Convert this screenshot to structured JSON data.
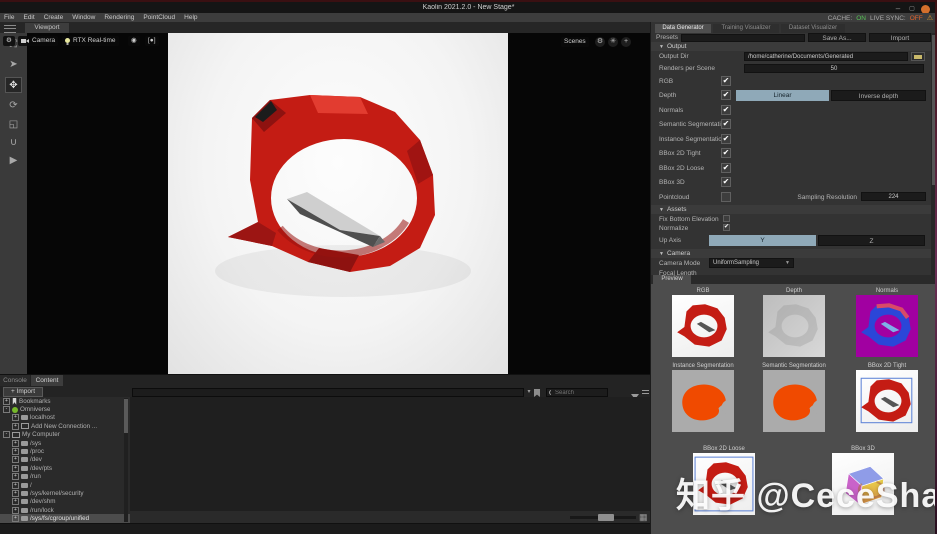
{
  "window": {
    "title": "Kaolin 2021.2.0 - New Stage*",
    "minimize": "–",
    "maximize": "▢",
    "cache_label": "CACHE:",
    "cache_value": "ON",
    "live_sync_label": "LIVE SYNC:",
    "live_sync_value": "OFF"
  },
  "menubar": {
    "items": [
      "File",
      "Edit",
      "Create",
      "Window",
      "Rendering",
      "PointCloud",
      "Help"
    ]
  },
  "viewport": {
    "tab_label": "Viewport",
    "camera_button": "Camera",
    "renderer_button": "RTX Real-time",
    "scenes_button": "Scenes",
    "speed_indicator": "[●]"
  },
  "generator": {
    "tabs": [
      "Data Generator",
      "Training Visualizer",
      "Dataset Visualizer"
    ],
    "active_tab": "Data Generator",
    "presets_label": "Presets",
    "save_as_button": "Save As...",
    "import_button": "Import",
    "output": {
      "header": "Output",
      "output_dir_label": "Output Dir",
      "output_dir_value": "/home/catherine/Documents/Generated",
      "renders_label": "Renders per Scene",
      "renders_value": "50",
      "rows": [
        {
          "label": "RGB",
          "checked": true
        },
        {
          "label": "Depth",
          "checked": true
        },
        {
          "label": "Normals",
          "checked": true
        },
        {
          "label": "Semantic Segmentation",
          "checked": true
        },
        {
          "label": "Instance Segmentation",
          "checked": true
        },
        {
          "label": "BBox 2D Tight",
          "checked": true
        },
        {
          "label": "BBox 2D Loose",
          "checked": true
        },
        {
          "label": "BBox 3D",
          "checked": true
        },
        {
          "label": "Pointcloud",
          "checked": false
        }
      ],
      "depth_mode_options": [
        "Linear",
        "Inverse depth"
      ],
      "depth_mode_selected": "Linear",
      "sampling_resolution_label": "Sampling Resolution",
      "sampling_resolution_value": "224"
    },
    "assets": {
      "header": "Assets",
      "fix_bottom_label": "Fix Bottom Elevation",
      "fix_bottom_checked": false,
      "normalize_label": "Normalize",
      "normalize_checked": true,
      "up_axis_label": "Up Axis",
      "up_axis_options": [
        "Y",
        "Z"
      ],
      "up_axis_selected": "Y"
    },
    "camera": {
      "header": "Camera",
      "mode_label": "Camera Mode",
      "mode_value": "UniformSampling",
      "focal_length_label": "Focal Length"
    },
    "preview": {
      "tab_label": "Preview",
      "thumb_labels": [
        "RGB",
        "Depth",
        "Normals",
        "Instance Segmentation",
        "Semantic Segmentation",
        "BBox 2D Tight",
        "BBox 2D Loose",
        "BBox 3D"
      ]
    }
  },
  "browser": {
    "console_tab": "Console",
    "content_tab": "Content",
    "active_tab": "Content",
    "import_button": "+ Import",
    "search_placeholder": "Search",
    "tree": [
      {
        "label": "Bookmarks",
        "toggle": "+",
        "icon": "bookmark",
        "depth": 0
      },
      {
        "label": "Omniverse",
        "toggle": "-",
        "icon": "omniverse",
        "depth": 0
      },
      {
        "label": "localhost",
        "toggle": "+",
        "icon": "server",
        "depth": 1
      },
      {
        "label": "Add New Connection ...",
        "toggle": "+",
        "icon": "connection",
        "depth": 1
      },
      {
        "label": "My Computer",
        "toggle": "-",
        "icon": "computer",
        "depth": 0
      },
      {
        "label": "/sys",
        "toggle": "+",
        "icon": "drive",
        "depth": 1
      },
      {
        "label": "/proc",
        "toggle": "+",
        "icon": "drive",
        "depth": 1
      },
      {
        "label": "/dev",
        "toggle": "+",
        "icon": "drive",
        "depth": 1
      },
      {
        "label": "/dev/pts",
        "toggle": "+",
        "icon": "drive",
        "depth": 1
      },
      {
        "label": "/run",
        "toggle": "+",
        "icon": "drive",
        "depth": 1
      },
      {
        "label": "/",
        "toggle": "+",
        "icon": "drive",
        "depth": 1
      },
      {
        "label": "/sys/kernel/security",
        "toggle": "+",
        "icon": "drive",
        "depth": 1
      },
      {
        "label": "/dev/shm",
        "toggle": "+",
        "icon": "drive",
        "depth": 1
      },
      {
        "label": "/run/lock",
        "toggle": "+",
        "icon": "drive",
        "depth": 1
      },
      {
        "label": "/sys/fs/cgroup/unified",
        "toggle": "+",
        "icon": "drive",
        "depth": 1,
        "selected": true
      }
    ]
  },
  "watermark": "知乎 @CeceSharp",
  "colors": {
    "accent_selected": "#8fa9b8",
    "cache_on": "#58c458",
    "live_sync_off": "#e0622e",
    "close_button": "#d4702c",
    "object_red": "#c41c14",
    "normals_bg": "#a100a1",
    "segmentation_orange": "#f04a00"
  }
}
